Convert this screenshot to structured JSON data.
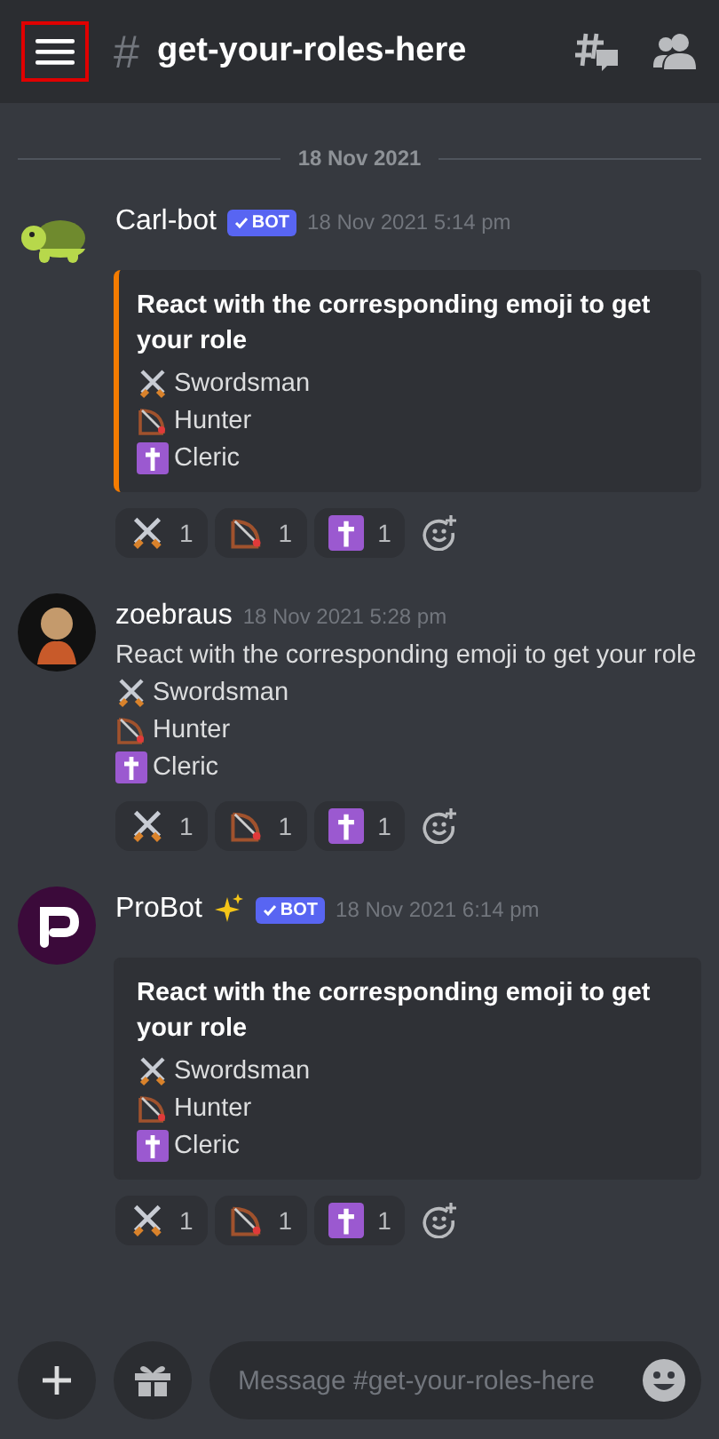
{
  "header": {
    "hash": "#",
    "channel": "get-your-roles-here",
    "menu_highlighted": true
  },
  "date_divider": "18 Nov 2021",
  "messages": [
    {
      "avatar": {
        "kind": "turtle"
      },
      "author": "Carl-bot",
      "sparkle": false,
      "badge": "BOT",
      "time": "18 Nov 2021 5:14 pm",
      "kind": "embed",
      "color": "#f57c00",
      "text": "React with the corresponding emoji to get your role",
      "roles": [
        {
          "kind": "swords",
          "label": "Swordsman"
        },
        {
          "kind": "bow",
          "label": "Hunter"
        },
        {
          "kind": "cross",
          "label": "Cleric"
        }
      ],
      "reactions": [
        {
          "kind": "swords",
          "count": "1"
        },
        {
          "kind": "bow",
          "count": "1"
        },
        {
          "kind": "cross",
          "count": "1"
        }
      ]
    },
    {
      "avatar": {
        "kind": "figure"
      },
      "author": "zoebraus",
      "sparkle": false,
      "time": "18 Nov 2021 5:28 pm",
      "kind": "plain",
      "text": "React with the corresponding emoji to get your role",
      "roles": [
        {
          "kind": "swords",
          "label": "Swordsman"
        },
        {
          "kind": "bow",
          "label": "Hunter"
        },
        {
          "kind": "cross",
          "label": "Cleric"
        }
      ],
      "reactions": [
        {
          "kind": "swords",
          "count": "1"
        },
        {
          "kind": "bow",
          "count": "1"
        },
        {
          "kind": "cross",
          "count": "1"
        }
      ]
    },
    {
      "avatar": {
        "kind": "logo"
      },
      "author": "ProBot",
      "sparkle": true,
      "badge": "BOT",
      "time": "18 Nov 2021 6:14 pm",
      "kind": "embed",
      "text": "React with the corresponding emoji to get your role",
      "roles": [
        {
          "kind": "swords",
          "label": "Swordsman"
        },
        {
          "kind": "bow",
          "label": "Hunter"
        },
        {
          "kind": "cross",
          "label": "Cleric"
        }
      ],
      "reactions": [
        {
          "kind": "swords",
          "count": "1"
        },
        {
          "kind": "bow",
          "count": "1"
        },
        {
          "kind": "cross",
          "count": "1"
        }
      ]
    }
  ],
  "composer": {
    "placeholder": "Message #get-your-roles-here"
  }
}
